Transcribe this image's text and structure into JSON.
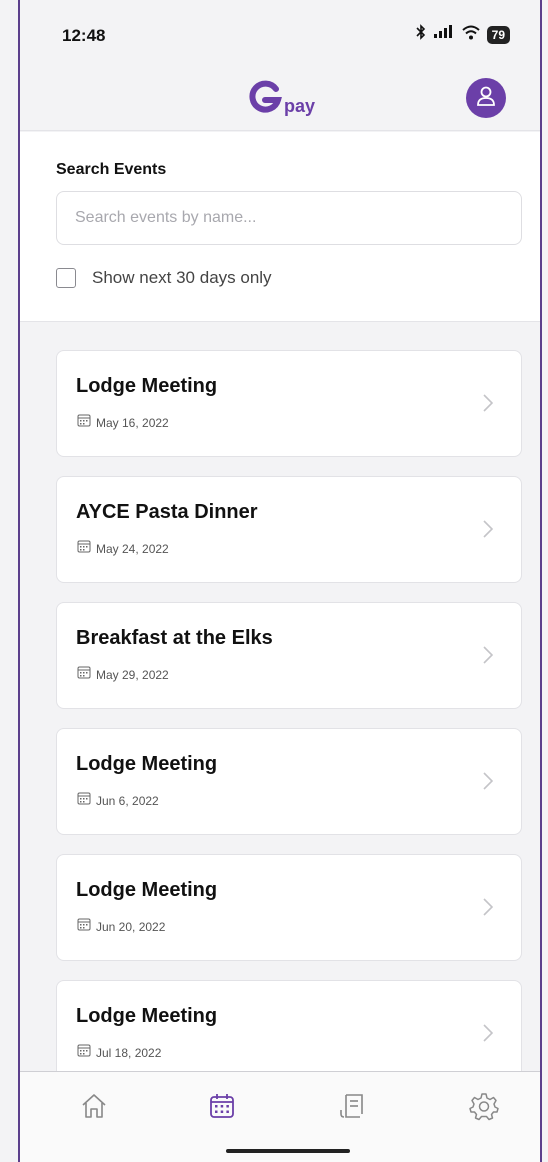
{
  "status_bar": {
    "time": "12:48",
    "battery": "79"
  },
  "header": {
    "logo_text": "pay",
    "brand_color": "#6b3fa8"
  },
  "search": {
    "label": "Search Events",
    "placeholder": "Search events by name...",
    "value": "",
    "filter_label": "Show next 30 days only",
    "filter_checked": false
  },
  "events": [
    {
      "title": "Lodge Meeting",
      "date": "May 16, 2022"
    },
    {
      "title": "AYCE Pasta Dinner",
      "date": "May 24, 2022"
    },
    {
      "title": "Breakfast at the Elks",
      "date": "May 29, 2022"
    },
    {
      "title": "Lodge Meeting",
      "date": "Jun 6, 2022"
    },
    {
      "title": "Lodge Meeting",
      "date": "Jun 20, 2022"
    },
    {
      "title": "Lodge Meeting",
      "date": "Jul 18, 2022"
    }
  ],
  "bottom_nav": {
    "items": [
      {
        "icon": "home-icon",
        "active": false
      },
      {
        "icon": "calendar-icon",
        "active": true
      },
      {
        "icon": "receipt-icon",
        "active": false
      },
      {
        "icon": "settings-gear-icon",
        "active": false
      }
    ],
    "active_color": "#6b3fa8",
    "inactive_color": "#888888"
  }
}
